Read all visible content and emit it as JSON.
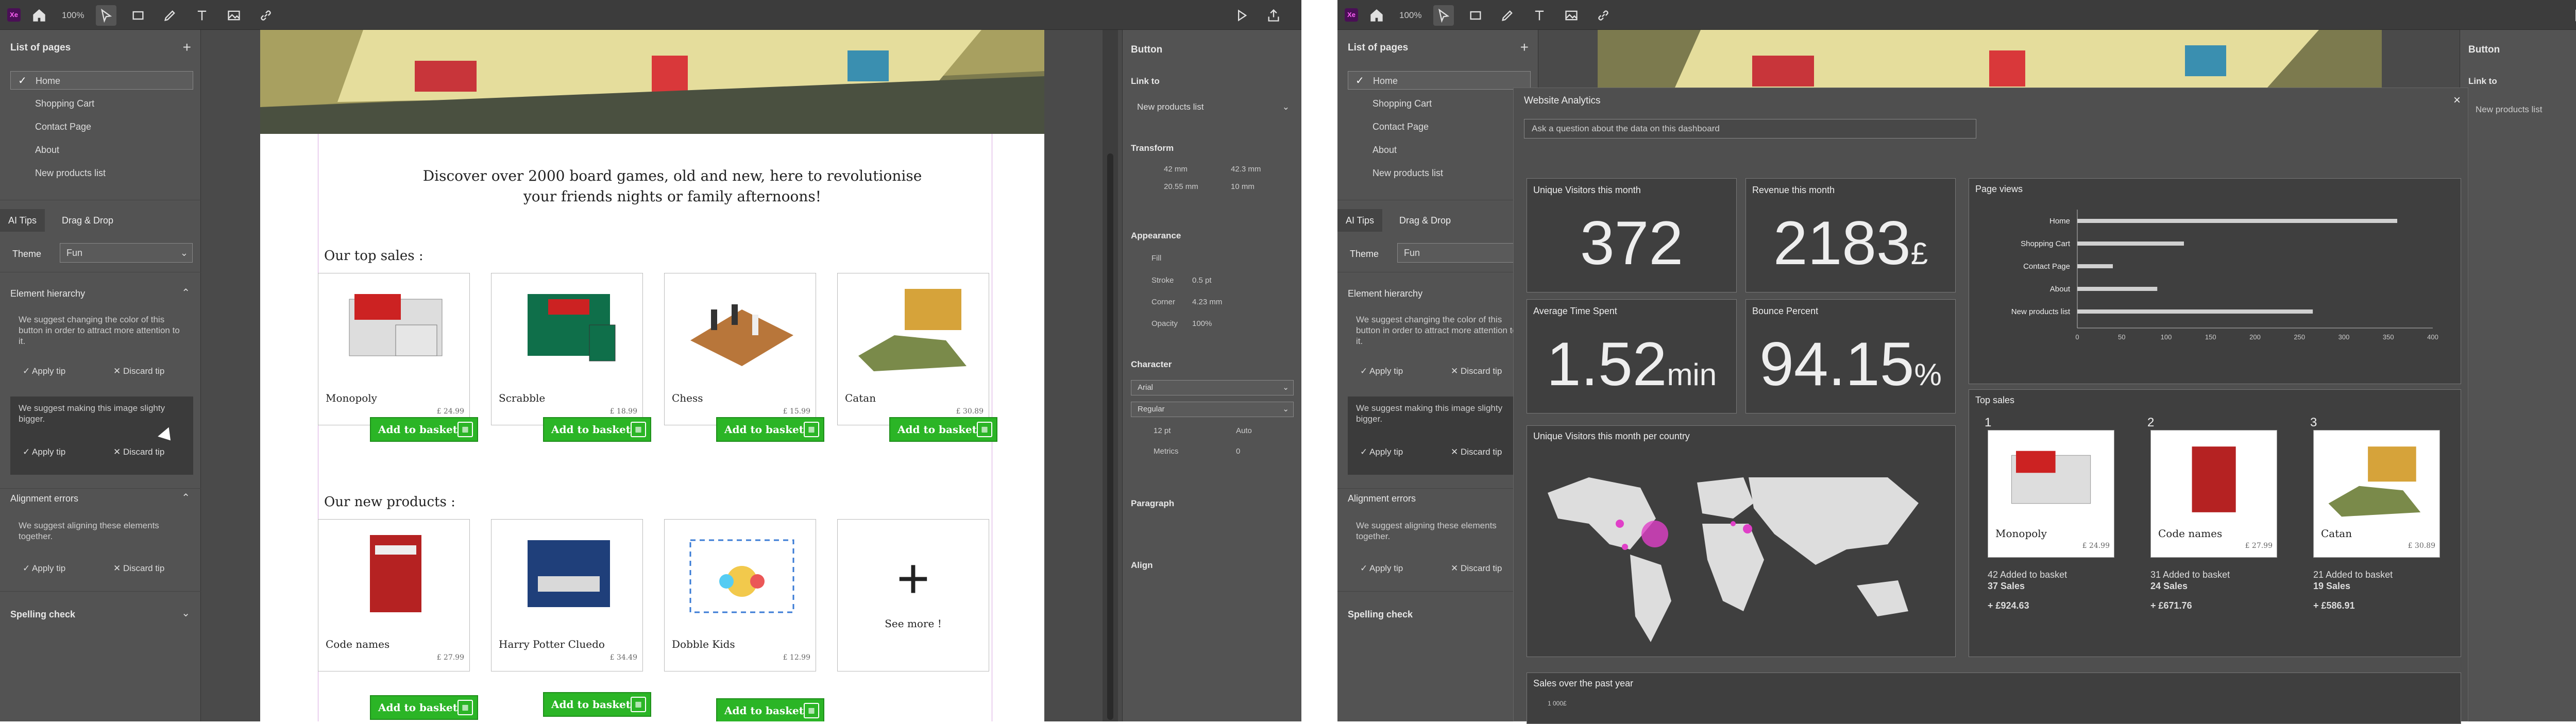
{
  "toolbar": {
    "zoom": "100%"
  },
  "pages": {
    "title": "List of pages",
    "items": [
      "Home",
      "Shopping Cart",
      "Contact Page",
      "About",
      "New products list"
    ]
  },
  "tabs": [
    "AI Tips",
    "Drag & Drop"
  ],
  "theme": {
    "label": "Theme",
    "value": "Fun"
  },
  "element_hierarchy": {
    "title": "Element hierarchy",
    "tip1": "We suggest changing the color of this button in order to attract more attention to it.",
    "tip2": "We suggest making this image slighty bigger."
  },
  "alignment": {
    "title": "Alignment errors",
    "tip": "We suggest aligning these elements together."
  },
  "spelling": {
    "title": "Spelling check"
  },
  "tip_actions": {
    "apply": "Apply tip",
    "discard": "Discard tip"
  },
  "document": {
    "intro": "Discover over 2000 board games, old and new, here to revolutionise your friends nights or family afternoons!",
    "top_sales_heading": "Our top sales :",
    "new_products_heading": "Our new products :",
    "add_label": "Add to basket",
    "top_sales": [
      {
        "name": "Monopoly",
        "price": "£ 24.99"
      },
      {
        "name": "Scrabble",
        "price": "£ 18.99"
      },
      {
        "name": "Chess",
        "price": "£ 15.99"
      },
      {
        "name": "Catan",
        "price": "£ 30.89"
      }
    ],
    "new_products": [
      {
        "name": "Code names",
        "price": "£ 27.99"
      },
      {
        "name": "Harry Potter Cluedo",
        "price": "£ 34.49"
      },
      {
        "name": "Dobble Kids",
        "price": "£ 12.99"
      }
    ],
    "see_more": "See more !"
  },
  "right_panel": {
    "button": "Button",
    "link_to": "Link to",
    "link_value": "New products list",
    "transform": "Transform",
    "x": "42 mm",
    "y": "20.55 mm",
    "w": "42.3 mm",
    "h": "10 mm",
    "appearance": "Appearance",
    "fill": "Fill",
    "stroke": "Stroke",
    "corner": "Corner",
    "opacity": "Opacity",
    "stroke_val": "0.5 pt",
    "corner_val": "4.23 mm",
    "opacity_val": "100%",
    "character": "Character",
    "font": "Arial",
    "style": "Regular",
    "size": "12 pt",
    "leading": "Auto",
    "metrics": "Metrics",
    "tracking": "0",
    "paragraph": "Paragraph",
    "align": "Align"
  },
  "analytics": {
    "title": "Website Analytics",
    "question_placeholder": "Ask a question about the data on this dashboard",
    "kpis": [
      {
        "label": "Unique Visitors this month",
        "value": "372",
        "unit": ""
      },
      {
        "label": "Revenue this month",
        "value": "2183",
        "unit": "£"
      },
      {
        "label": "Average Time Spent",
        "value": "1.52",
        "unit": "min"
      },
      {
        "label": "Bounce Percent",
        "value": "94.15",
        "unit": "%"
      }
    ],
    "map_title": "Unique Visitors this month per country",
    "top_sales_title": "Top sales",
    "top_sales": [
      {
        "rank": "1",
        "name": "Monopoly",
        "price": "£ 24.99",
        "added": "42 Added to basket",
        "sales": "37 Sales",
        "revenue": "+ £924.63"
      },
      {
        "rank": "2",
        "name": "Code names",
        "price": "£ 27.99",
        "added": "31 Added to basket",
        "sales": "24 Sales",
        "revenue": "+ £671.76"
      },
      {
        "rank": "3",
        "name": "Catan",
        "price": "£ 30.89",
        "added": "21 Added to basket",
        "sales": "19 Sales",
        "revenue": "+ £586.91"
      }
    ],
    "sales_title": "Sales over the past year",
    "sales_y_top": "1 000£"
  },
  "chart_data": {
    "type": "bar",
    "title": "Page views",
    "categories": [
      "Home",
      "Shopping Cart",
      "Contact Page",
      "About",
      "New products list"
    ],
    "values": [
      360,
      120,
      40,
      90,
      265
    ],
    "xlim": [
      0,
      400
    ],
    "xticks": [
      "0",
      "50",
      "100",
      "150",
      "200",
      "250",
      "300",
      "350",
      "400"
    ]
  }
}
